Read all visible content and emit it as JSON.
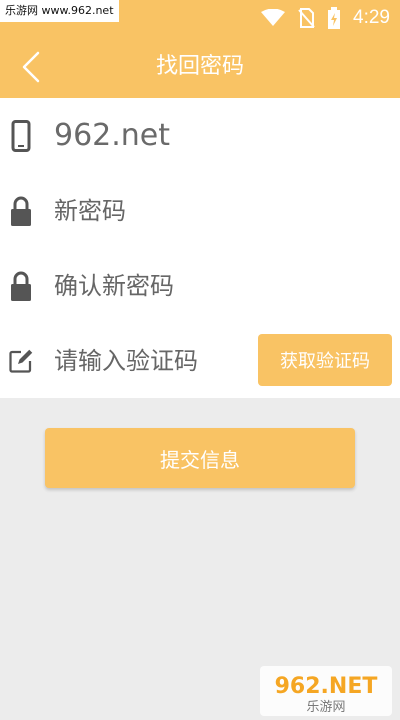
{
  "watermark_top": "乐游网 www.962.net",
  "status_bar": {
    "time": "4:29"
  },
  "header": {
    "title": "找回密码"
  },
  "form": {
    "phone_value": "962.net",
    "new_password_placeholder": "新密码",
    "confirm_password_placeholder": "确认新密码",
    "code_placeholder": "请输入验证码",
    "get_code_label": "获取验证码"
  },
  "submit_label": "提交信息",
  "watermark_bottom": {
    "logo": "962.NET",
    "tagline": "乐游网"
  },
  "colors": {
    "accent": "#f9c364",
    "background": "#ececec",
    "icon": "#555555"
  },
  "icons": {
    "back": "chevron-left-icon",
    "phone": "phone-icon",
    "lock": "lock-icon",
    "edit": "edit-icon",
    "wifi": "wifi-icon",
    "no_sim": "no-sim-icon",
    "battery": "battery-charging-icon"
  }
}
